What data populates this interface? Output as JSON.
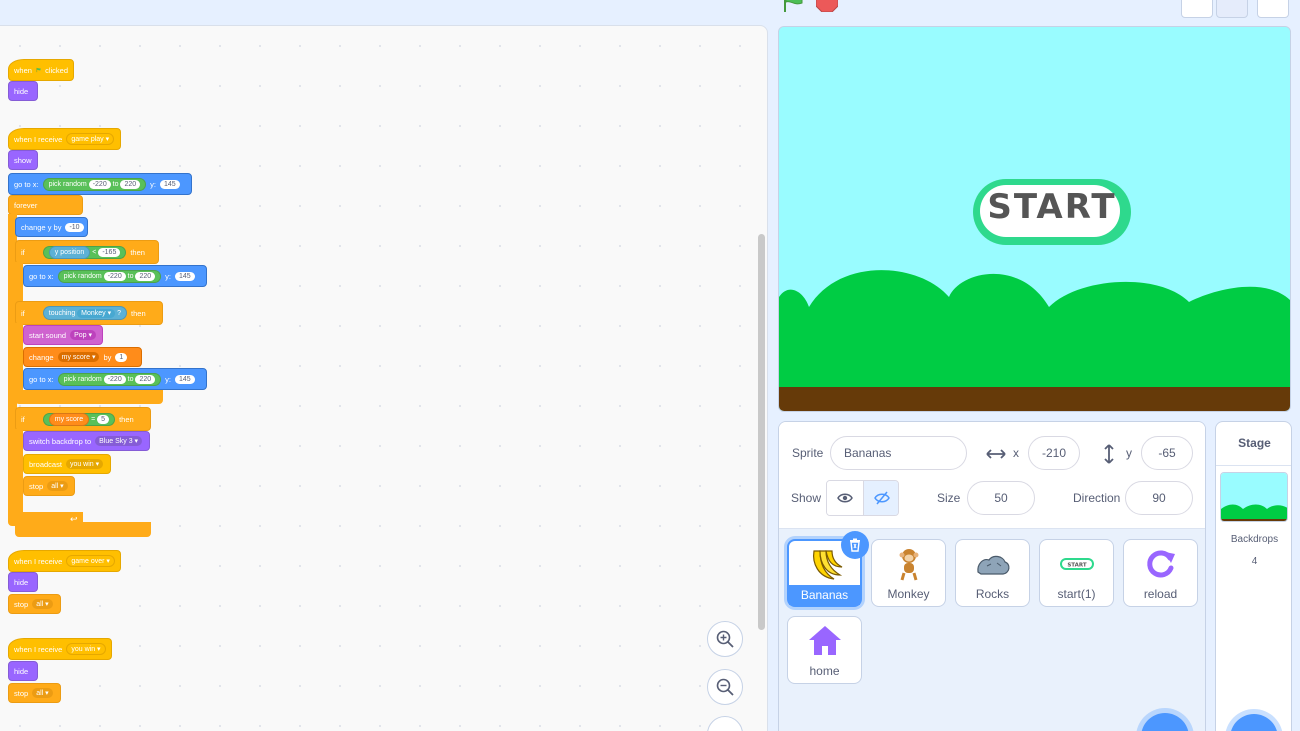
{
  "code": {
    "script1": {
      "hat_pre": "when",
      "hat_post": "clicked",
      "hide": "hide"
    },
    "script2": {
      "hat": "when I receive",
      "message": "game play",
      "show": "show",
      "goto_a": {
        "goto": "go to x:",
        "random": "pick random",
        "from": "-220",
        "to_word": "to",
        "to": "220",
        "y": "y:",
        "yval": "145"
      },
      "forever": "forever",
      "change_y": {
        "label": "change y by",
        "value": "-10"
      },
      "if1": {
        "if": "if",
        "ypos": "y position",
        "op": "<",
        "value": "-165",
        "then": "then"
      },
      "goto_b": {
        "goto": "go to x:",
        "random": "pick random",
        "from": "-220",
        "to_word": "to",
        "to": "220",
        "y": "y:",
        "yval": "145"
      },
      "if2": {
        "if": "if",
        "touching": "touching",
        "target": "Monkey",
        "q": "?",
        "then": "then"
      },
      "sound": {
        "label": "start sound",
        "value": "Pop"
      },
      "change_score": {
        "change": "change",
        "var": "my score",
        "by": "by",
        "value": "1"
      },
      "goto_c": {
        "goto": "go to x:",
        "random": "pick random",
        "from": "-220",
        "to_word": "to",
        "to": "220",
        "y": "y:",
        "yval": "145"
      },
      "if3": {
        "if": "if",
        "var": "my score",
        "op": "=",
        "value": "5",
        "then": "then"
      },
      "backdrop": {
        "label": "switch backdrop to",
        "value": "Blue Sky 3"
      },
      "broadcast": {
        "label": "broadcast",
        "value": "you win"
      },
      "stop": {
        "label": "stop",
        "value": "all"
      }
    },
    "script3": {
      "hat": "when I receive",
      "message": "game over",
      "hide": "hide",
      "stop": "stop",
      "stop_value": "all"
    },
    "script4": {
      "hat": "when I receive",
      "message": "you win",
      "hide": "hide",
      "stop": "stop",
      "stop_value": "all"
    },
    "zoom": {
      "in_icon": "zoom-in-icon",
      "out_icon": "zoom-out-icon",
      "reset_icon": "zoom-reset-icon"
    }
  },
  "stage": {
    "button_text": "START"
  },
  "sprite_info": {
    "sprite_label": "Sprite",
    "sprite_name": "Bananas",
    "x_label": "x",
    "x_value": "-210",
    "y_label": "y",
    "y_value": "-65",
    "show_label": "Show",
    "size_label": "Size",
    "size_value": "50",
    "direction_label": "Direction",
    "direction_value": "90"
  },
  "sprites": [
    {
      "name": "Bananas"
    },
    {
      "name": "Monkey"
    },
    {
      "name": "Rocks"
    },
    {
      "name": "start(1)"
    },
    {
      "name": "reload"
    },
    {
      "name": "home"
    }
  ],
  "stage_pane": {
    "title": "Stage",
    "backdrops_label": "Backdrops",
    "backdrops_count": "4"
  },
  "colors": {
    "accent": "#4c97ff",
    "events": "#ffbf00",
    "looks": "#9966ff",
    "control": "#ffab19",
    "operators": "#59c059",
    "sky": "#99fcff",
    "grass": "#00cc44",
    "ground": "#663a09"
  }
}
